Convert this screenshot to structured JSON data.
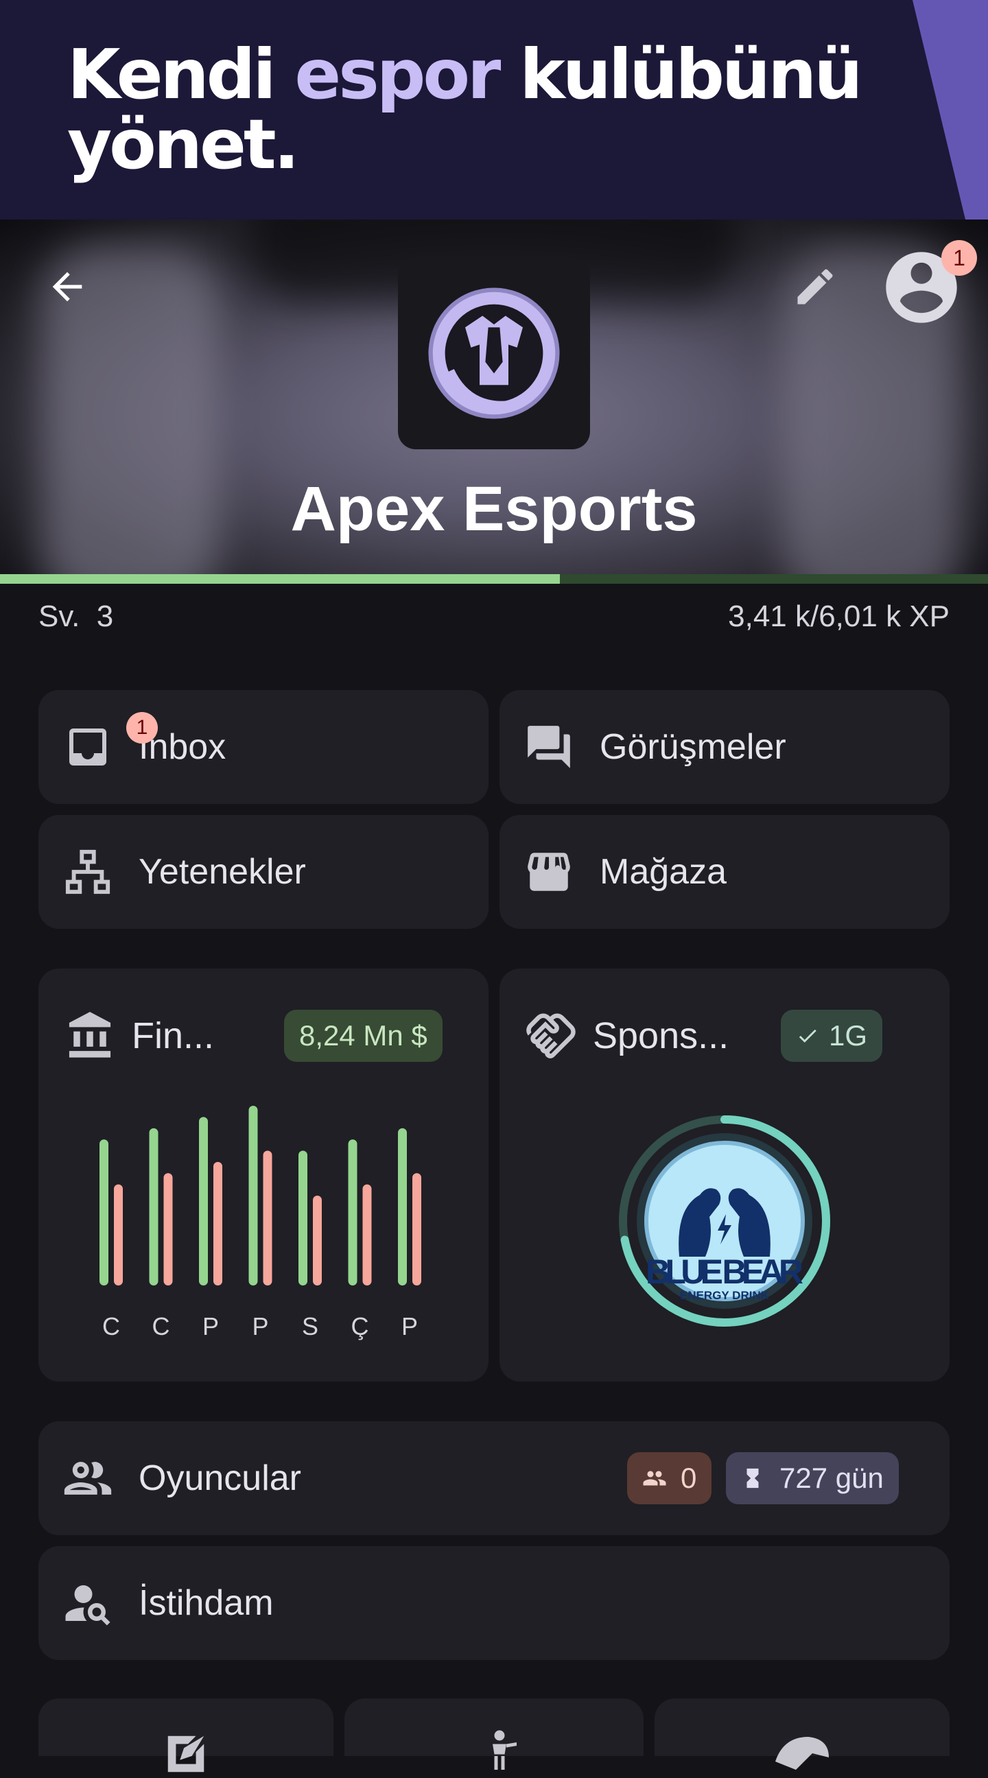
{
  "promo": {
    "headline_before": "Kendi ",
    "headline_accent": "espor",
    "headline_after": " kulübünü yönet."
  },
  "club": {
    "name": "Apex Esports",
    "notification_count": "1"
  },
  "progress": {
    "level_label": "Sv.  3",
    "xp_text": "3,41 k/6,01 k XP",
    "xp_fraction": 0.567
  },
  "menu": {
    "inbox": {
      "label": "Inbox",
      "badge": "1"
    },
    "conversations": {
      "label": "Görüşmeler"
    },
    "skills": {
      "label": "Yetenekler"
    },
    "shop": {
      "label": "Mağaza"
    }
  },
  "finance": {
    "title": "Fin...",
    "balance": "8,24 Mn $"
  },
  "chart_data": {
    "type": "bar",
    "categories": [
      "C",
      "C",
      "P",
      "P",
      "S",
      "Ç",
      "P"
    ],
    "series": [
      {
        "values": [
          13,
          14,
          15,
          16,
          12,
          13,
          14
        ],
        "color": "#95d58f"
      },
      {
        "values": [
          9,
          10,
          11,
          12,
          8,
          9,
          10
        ],
        "color": "#f7a79b"
      }
    ],
    "title": "",
    "xlabel": "",
    "ylabel": "",
    "ylim": [
      0,
      16
    ],
    "grid": false
  },
  "sponsor": {
    "title": "Spons...",
    "status": "1G",
    "logo_text": "BLUE BEAR",
    "logo_subtext": "ENERGY DRINK",
    "progress_fraction": 0.72
  },
  "players": {
    "label": "Oyuncular",
    "count": "0",
    "days": "727 gün"
  },
  "recruit": {
    "label": "İstihdam"
  },
  "colors": {
    "accent_green": "#95d58f",
    "accent_red": "#f7a79b",
    "purple": "#c9bdf6",
    "banner": "#1c1838"
  }
}
